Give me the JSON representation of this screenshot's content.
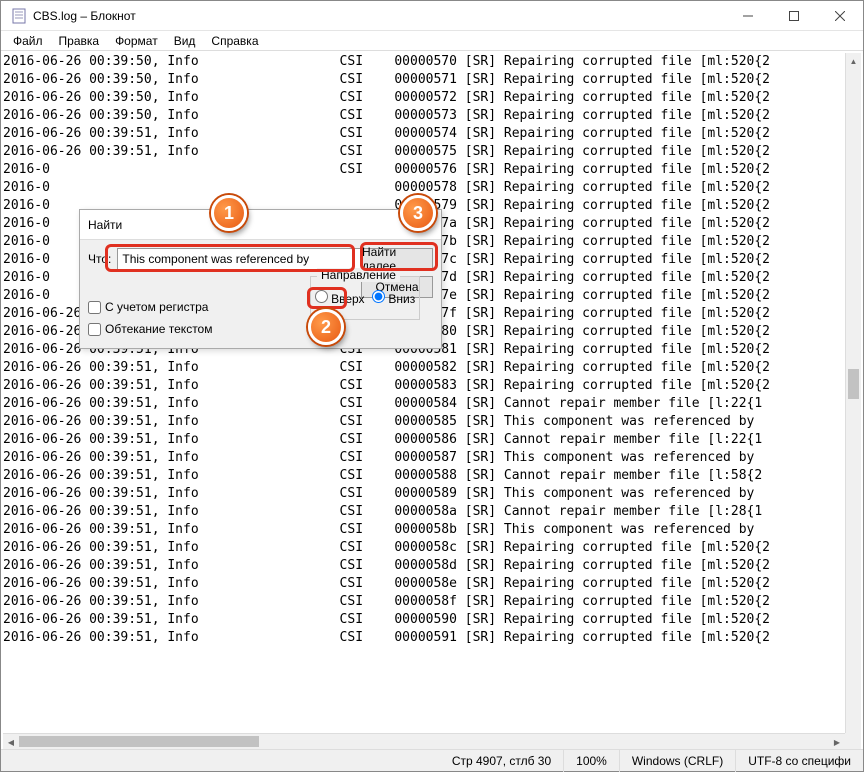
{
  "window": {
    "title": "CBS.log – Блокнот"
  },
  "menu": {
    "file": "Файл",
    "edit": "Правка",
    "format": "Формат",
    "view": "Вид",
    "help": "Справка"
  },
  "find": {
    "title": "Найти",
    "what_label": "Что:",
    "what_value": "This component was referenced by",
    "find_next": "Найти далее",
    "cancel": "Отмена",
    "direction": "Направление",
    "up": "Вверх",
    "down": "Вниз",
    "match_case": "С учетом регистра",
    "wrap": "Обтекание текстом"
  },
  "status": {
    "pos": "Стр 4907, стлб 30",
    "zoom": "100%",
    "eol": "Windows (CRLF)",
    "enc": "UTF-8 со специфи"
  },
  "callouts": {
    "c1": "1",
    "c2": "2",
    "c3": "3"
  },
  "lines": [
    "2016-06-26 00:39:50, Info                  CSI    00000570 [SR] Repairing corrupted file [ml:520{2",
    "2016-06-26 00:39:50, Info                  CSI    00000571 [SR] Repairing corrupted file [ml:520{2",
    "2016-06-26 00:39:50, Info                  CSI    00000572 [SR] Repairing corrupted file [ml:520{2",
    "2016-06-26 00:39:50, Info                  CSI    00000573 [SR] Repairing corrupted file [ml:520{2",
    "2016-06-26 00:39:51, Info                  CSI    00000574 [SR] Repairing corrupted file [ml:520{2",
    "2016-06-26 00:39:51, Info                  CSI    00000575 [SR] Repairing corrupted file [ml:520{2",
    "2016-0                                     CSI    00000576 [SR] Repairing corrupted file [ml:520{2",
    "2016-0                                            00000578 [SR] Repairing corrupted file [ml:520{2",
    "2016-0                                            00000579 [SR] Repairing corrupted file [ml:520{2",
    "2016-0                                            0000057a [SR] Repairing corrupted file [ml:520{2",
    "2016-0                                            0000057b [SR] Repairing corrupted file [ml:520{2",
    "2016-0                                            0000057c [SR] Repairing corrupted file [ml:520{2",
    "2016-0                                            0000057d [SR] Repairing corrupted file [ml:520{2",
    "2016-0                                            0000057e [SR] Repairing corrupted file [ml:520{2",
    "2016-06-26 00:39:51, Info                  CSI    0000057f [SR] Repairing corrupted file [ml:520{2",
    "2016-06-26 00:39:51, Info                  CSI    00000580 [SR] Repairing corrupted file [ml:520{2",
    "2016-06-26 00:39:51, Info                  CSI    00000581 [SR] Repairing corrupted file [ml:520{2",
    "2016-06-26 00:39:51, Info                  CSI    00000582 [SR] Repairing corrupted file [ml:520{2",
    "2016-06-26 00:39:51, Info                  CSI    00000583 [SR] Repairing corrupted file [ml:520{2",
    "2016-06-26 00:39:51, Info                  CSI    00000584 [SR] Cannot repair member file [l:22{1",
    "2016-06-26 00:39:51, Info                  CSI    00000585 [SR] This component was referenced by ",
    "2016-06-26 00:39:51, Info                  CSI    00000586 [SR] Cannot repair member file [l:22{1",
    "2016-06-26 00:39:51, Info                  CSI    00000587 [SR] This component was referenced by ",
    "2016-06-26 00:39:51, Info                  CSI    00000588 [SR] Cannot repair member file [l:58{2",
    "2016-06-26 00:39:51, Info                  CSI    00000589 [SR] This component was referenced by ",
    "2016-06-26 00:39:51, Info                  CSI    0000058a [SR] Cannot repair member file [l:28{1",
    "2016-06-26 00:39:51, Info                  CSI    0000058b [SR] This component was referenced by ",
    "2016-06-26 00:39:51, Info                  CSI    0000058c [SR] Repairing corrupted file [ml:520{2",
    "2016-06-26 00:39:51, Info                  CSI    0000058d [SR] Repairing corrupted file [ml:520{2",
    "2016-06-26 00:39:51, Info                  CSI    0000058e [SR] Repairing corrupted file [ml:520{2",
    "2016-06-26 00:39:51, Info                  CSI    0000058f [SR] Repairing corrupted file [ml:520{2",
    "2016-06-26 00:39:51, Info                  CSI    00000590 [SR] Repairing corrupted file [ml:520{2",
    "2016-06-26 00:39:51, Info                  CSI    00000591 [SR] Repairing corrupted file [ml:520{2"
  ]
}
